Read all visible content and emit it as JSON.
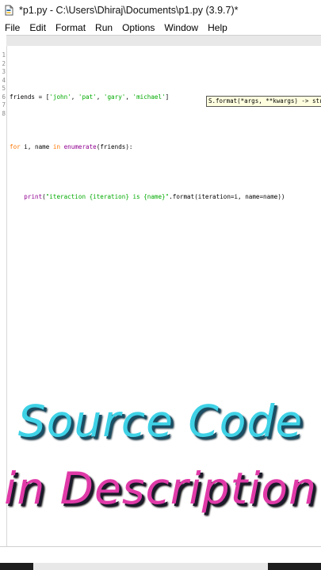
{
  "window": {
    "title": "*p1.py - C:\\Users\\Dhiraj\\Documents\\p1.py (3.9.7)*",
    "icon": "python-file-icon"
  },
  "menu": [
    "File",
    "Edit",
    "Format",
    "Run",
    "Options",
    "Window",
    "Help"
  ],
  "line_numbers": [
    "1",
    "2",
    "3",
    "4",
    "5",
    "6",
    "7",
    "8"
  ],
  "code": {
    "line2": {
      "var": "friends = [",
      "s1": "'john'",
      "c1": ", ",
      "s2": "'pat'",
      "c2": ", ",
      "s3": "'gary'",
      "c3": ", ",
      "s4": "'michael'",
      "end": "]"
    },
    "line4": {
      "kw_for": "for",
      "mid1": " i, name ",
      "kw_in": "in",
      "sp": " ",
      "fn": "enumerate",
      "end": "(friends):"
    },
    "line6": {
      "indent": "    ",
      "fn": "print",
      "open": "(",
      "str": "\"iteraction {iteration} is {name}\"",
      "end": ".format(iteration=i, name=name))"
    }
  },
  "calltip": "S.format(*args, **kwargs) -> str",
  "promo": {
    "line1": "Source Code",
    "line2": "in Description"
  },
  "colors": {
    "keyword": "#ff7700",
    "builtin": "#900090",
    "string": "#00aa00",
    "promo_cyan": "#3fd2e6",
    "promo_pink": "#e03aa8"
  }
}
